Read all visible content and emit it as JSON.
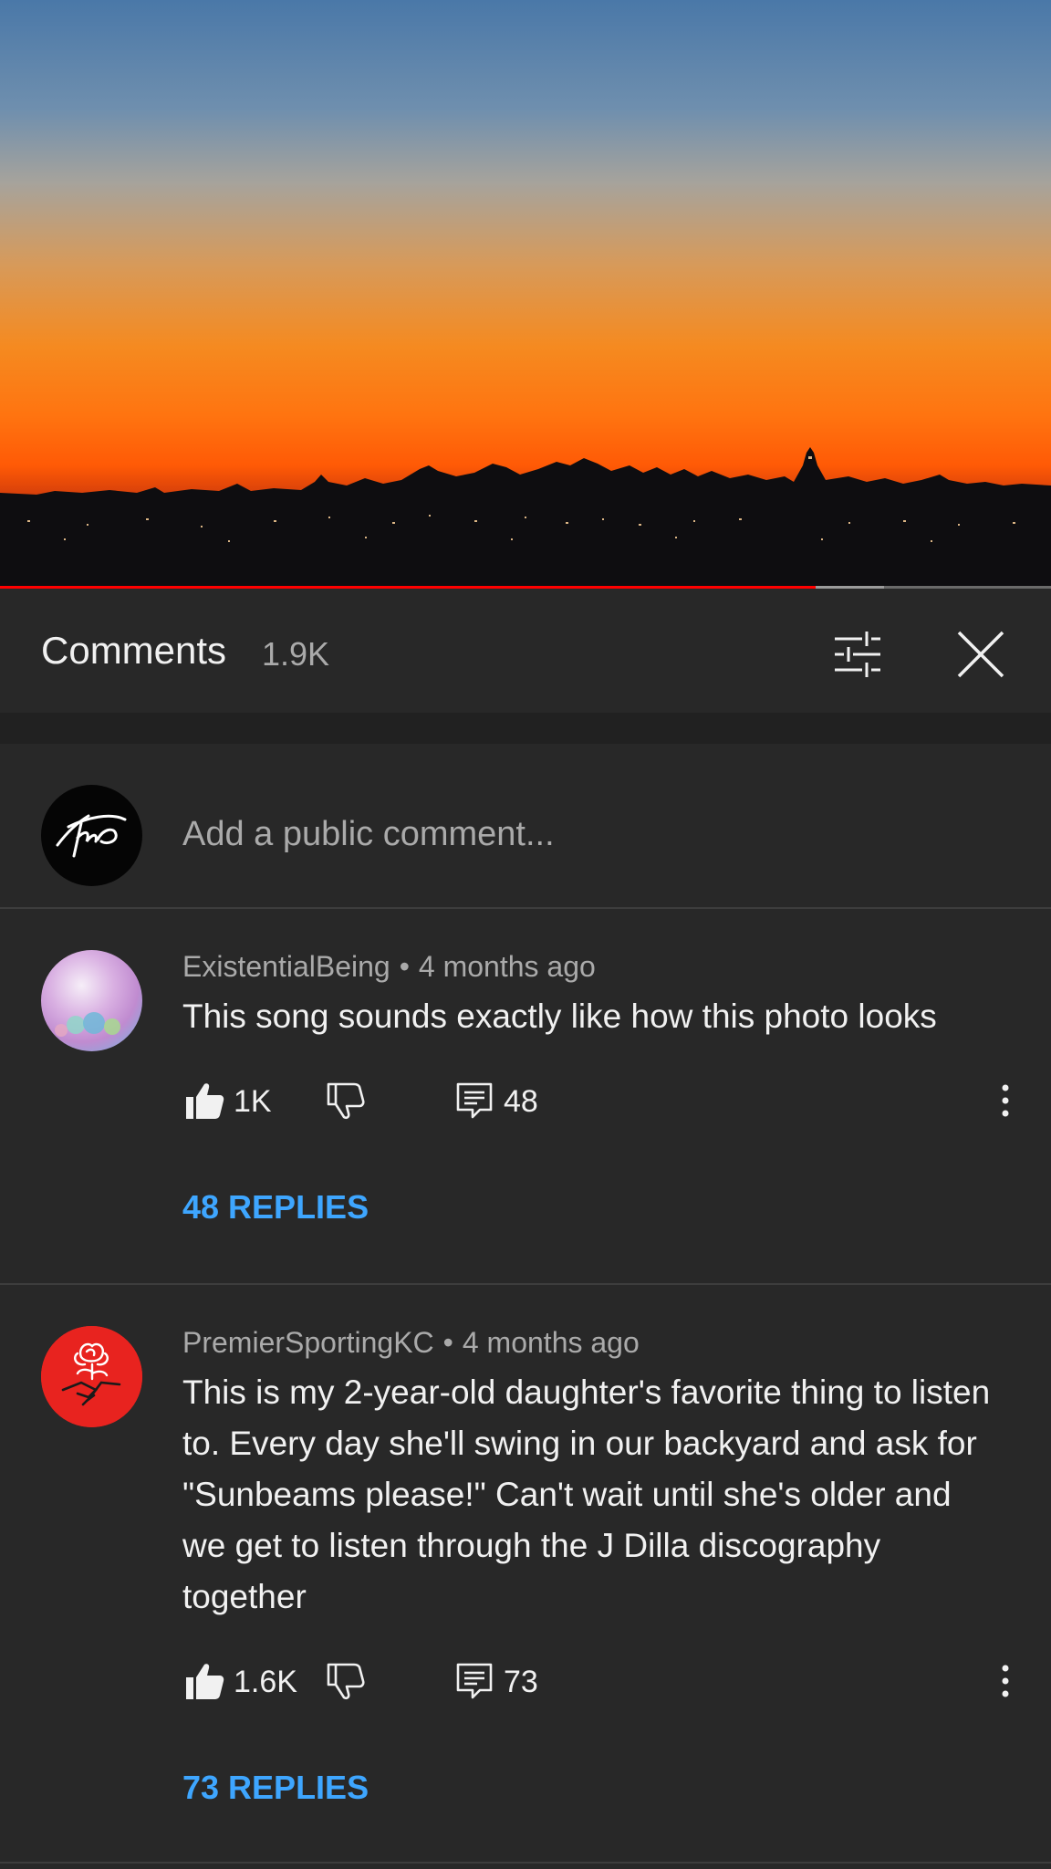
{
  "video": {
    "progress_played": 0.776,
    "progress_buffered": 0.841
  },
  "header": {
    "title": "Comments",
    "count": "1.9K"
  },
  "add_comment": {
    "placeholder": "Add a public comment..."
  },
  "comments": [
    {
      "author": "ExistentialBeing",
      "separator": "•",
      "time": "4 months ago",
      "text": "This song sounds exactly like how this photo looks",
      "likes": "1K",
      "reply_count": "48",
      "replies_label": "48 REPLIES"
    },
    {
      "author": "PremierSportingKC",
      "separator": "•",
      "time": "4 months ago",
      "text": "This is my 2-year-old daughter's favorite thing to listen to. Every day she'll swing in our backyard and ask for \"Sunbeams please!\" Can't wait until she's older and we get to listen through the J Dilla discography together",
      "likes": "1.6K",
      "reply_count": "73",
      "replies_label": "73 REPLIES"
    }
  ],
  "colors": {
    "background": "#282828",
    "accent_link": "#3ea6ff",
    "progress_red": "#ff0000",
    "secondary_text": "#aaaaaa"
  },
  "icons": [
    "thumbs-up-icon",
    "thumbs-down-icon",
    "reply-icon",
    "more-vertical-icon",
    "filter-icon",
    "close-icon"
  ]
}
